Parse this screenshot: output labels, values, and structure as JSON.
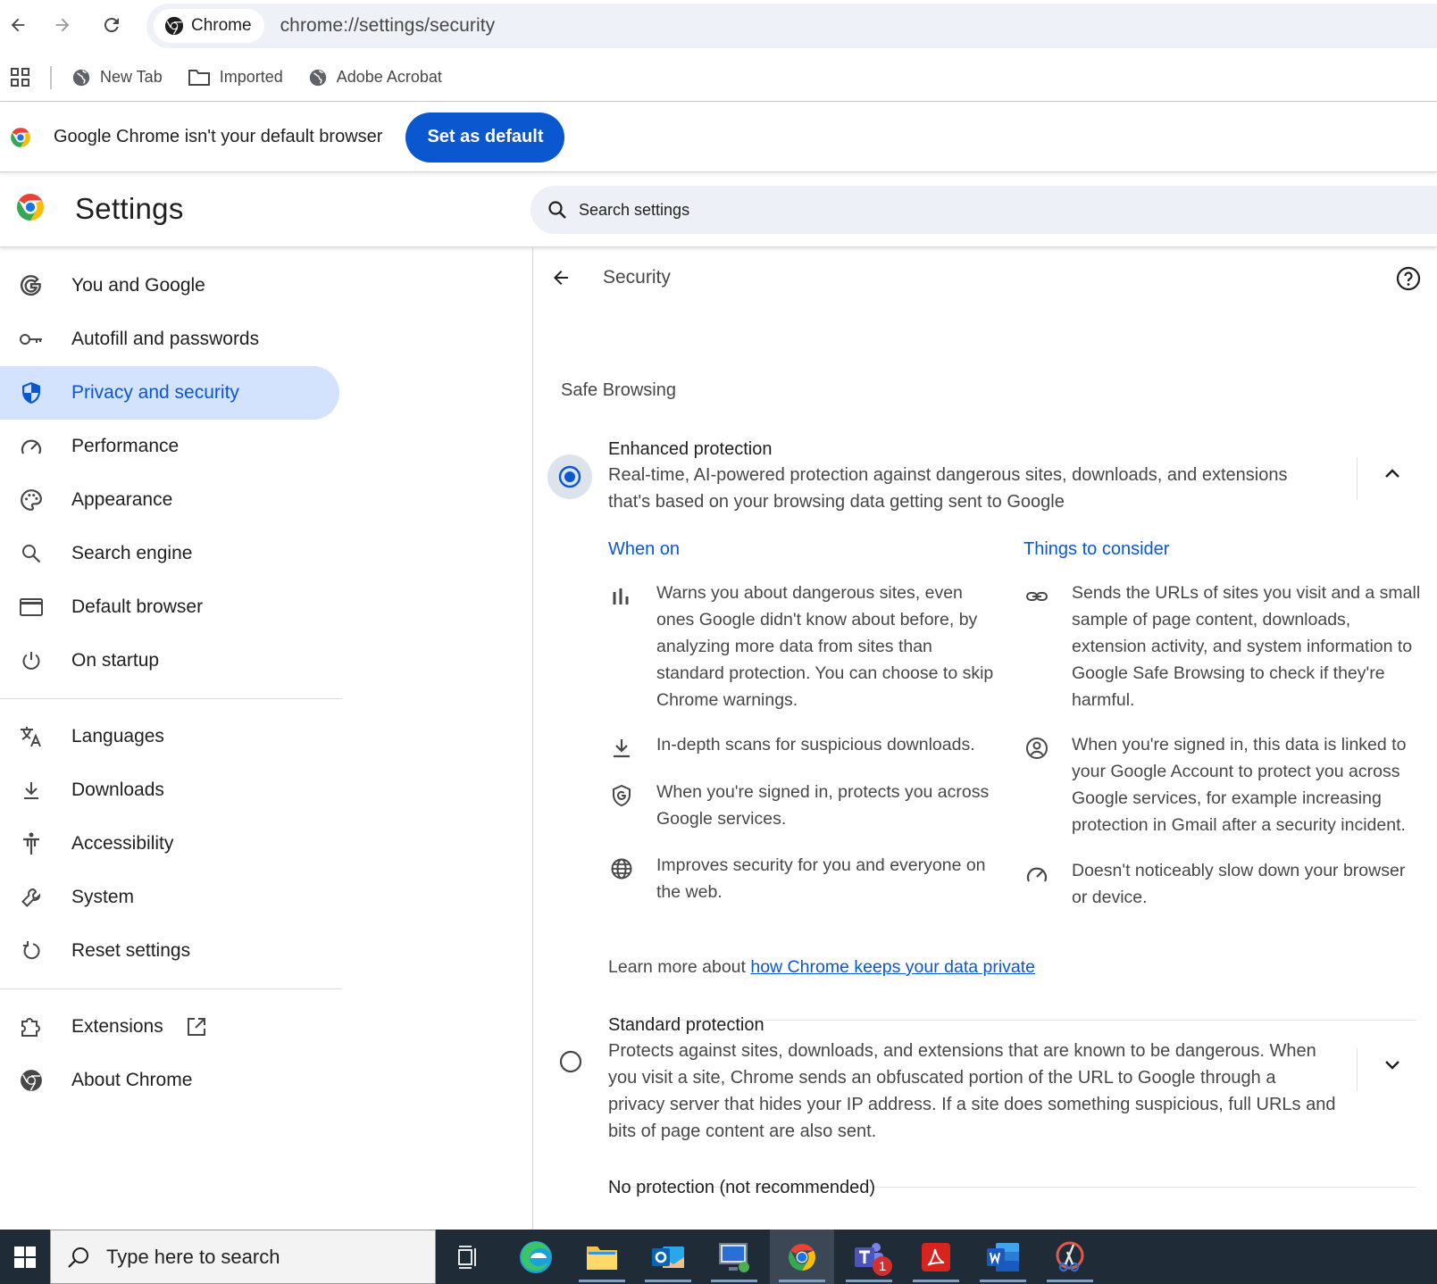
{
  "toolbar": {
    "chip_label": "Chrome",
    "url": "chrome://settings/security"
  },
  "bookmarks": [
    {
      "label": "New Tab",
      "icon": "globe-icon"
    },
    {
      "label": "Imported",
      "icon": "folder-icon"
    },
    {
      "label": "Adobe Acrobat",
      "icon": "globe-icon"
    }
  ],
  "infobar": {
    "text": "Google Chrome isn't your default browser",
    "button": "Set as default"
  },
  "header": {
    "title": "Settings",
    "search_placeholder": "Search settings"
  },
  "sidebar": {
    "items": [
      {
        "label": "You and Google",
        "icon": "google-g-icon"
      },
      {
        "label": "Autofill and passwords",
        "icon": "key-icon"
      },
      {
        "label": "Privacy and security",
        "icon": "shield-icon",
        "active": true
      },
      {
        "label": "Performance",
        "icon": "speedometer-icon"
      },
      {
        "label": "Appearance",
        "icon": "palette-icon"
      },
      {
        "label": "Search engine",
        "icon": "search-icon"
      },
      {
        "label": "Default browser",
        "icon": "browser-window-icon"
      },
      {
        "label": "On startup",
        "icon": "power-icon"
      },
      {
        "label": "Languages",
        "icon": "translate-icon"
      },
      {
        "label": "Downloads",
        "icon": "download-icon"
      },
      {
        "label": "Accessibility",
        "icon": "accessibility-icon"
      },
      {
        "label": "System",
        "icon": "wrench-icon"
      },
      {
        "label": "Reset settings",
        "icon": "reset-icon"
      },
      {
        "label": "Extensions",
        "icon": "puzzle-icon"
      },
      {
        "label": "About Chrome",
        "icon": "chrome-logo-icon"
      }
    ]
  },
  "security": {
    "page_title": "Security",
    "section_title": "Safe Browsing",
    "enhanced": {
      "title": "Enhanced protection",
      "description": "Real-time, AI-powered protection against dangerous sites, downloads, and extensions that's based on your browsing data getting sent to Google",
      "selected": true,
      "when_on_heading": "When on",
      "consider_heading": "Things to consider",
      "when_on": [
        {
          "icon": "bar-chart-icon",
          "text": "Warns you about dangerous sites, even ones Google didn't know about before, by analyzing more data from sites than standard protection. You can choose to skip Chrome warnings."
        },
        {
          "icon": "download-icon",
          "text": "In-depth scans for suspicious downloads."
        },
        {
          "icon": "google-shield-icon",
          "text": "When you're signed in, protects you across Google services."
        },
        {
          "icon": "globe-icon",
          "text": "Improves security for you and everyone on the web."
        }
      ],
      "consider": [
        {
          "icon": "link-icon",
          "text": "Sends the URLs of sites you visit and a small sample of page content, downloads, extension activity, and system information to Google Safe Browsing to check if they're harmful."
        },
        {
          "icon": "account-circle-icon",
          "text": "When you're signed in, this data is linked to your Google Account to protect you across Google services, for example increasing protection in Gmail after a security incident."
        },
        {
          "icon": "speedometer-icon",
          "text": "Doesn't noticeably slow down your browser or device."
        }
      ],
      "learn_more_prefix": "Learn more about ",
      "learn_more_link": "how Chrome keeps your data private"
    },
    "standard": {
      "title": "Standard protection",
      "description": "Protects against sites, downloads, and extensions that are known to be dangerous. When you visit a site, Chrome sends an obfuscated portion of the URL to Google through a privacy server that hides your IP address. If a site does something suspicious, full URLs and bits of page content are also sent.",
      "selected": false
    },
    "none": {
      "title": "No protection (not recommended)"
    }
  },
  "taskbar": {
    "search_placeholder": "Type here to search",
    "teams_badge": "1",
    "apps": [
      "task-view",
      "edge",
      "file-explorer",
      "outlook",
      "remote-desktop",
      "chrome",
      "teams",
      "acrobat",
      "word",
      "snipping-tool"
    ]
  },
  "colors": {
    "accent": "#0b57d0",
    "active_nav_bg": "#d3e3fd",
    "omnibox_bg": "#eef1f8",
    "taskbar_bg": "#1f2b36"
  }
}
